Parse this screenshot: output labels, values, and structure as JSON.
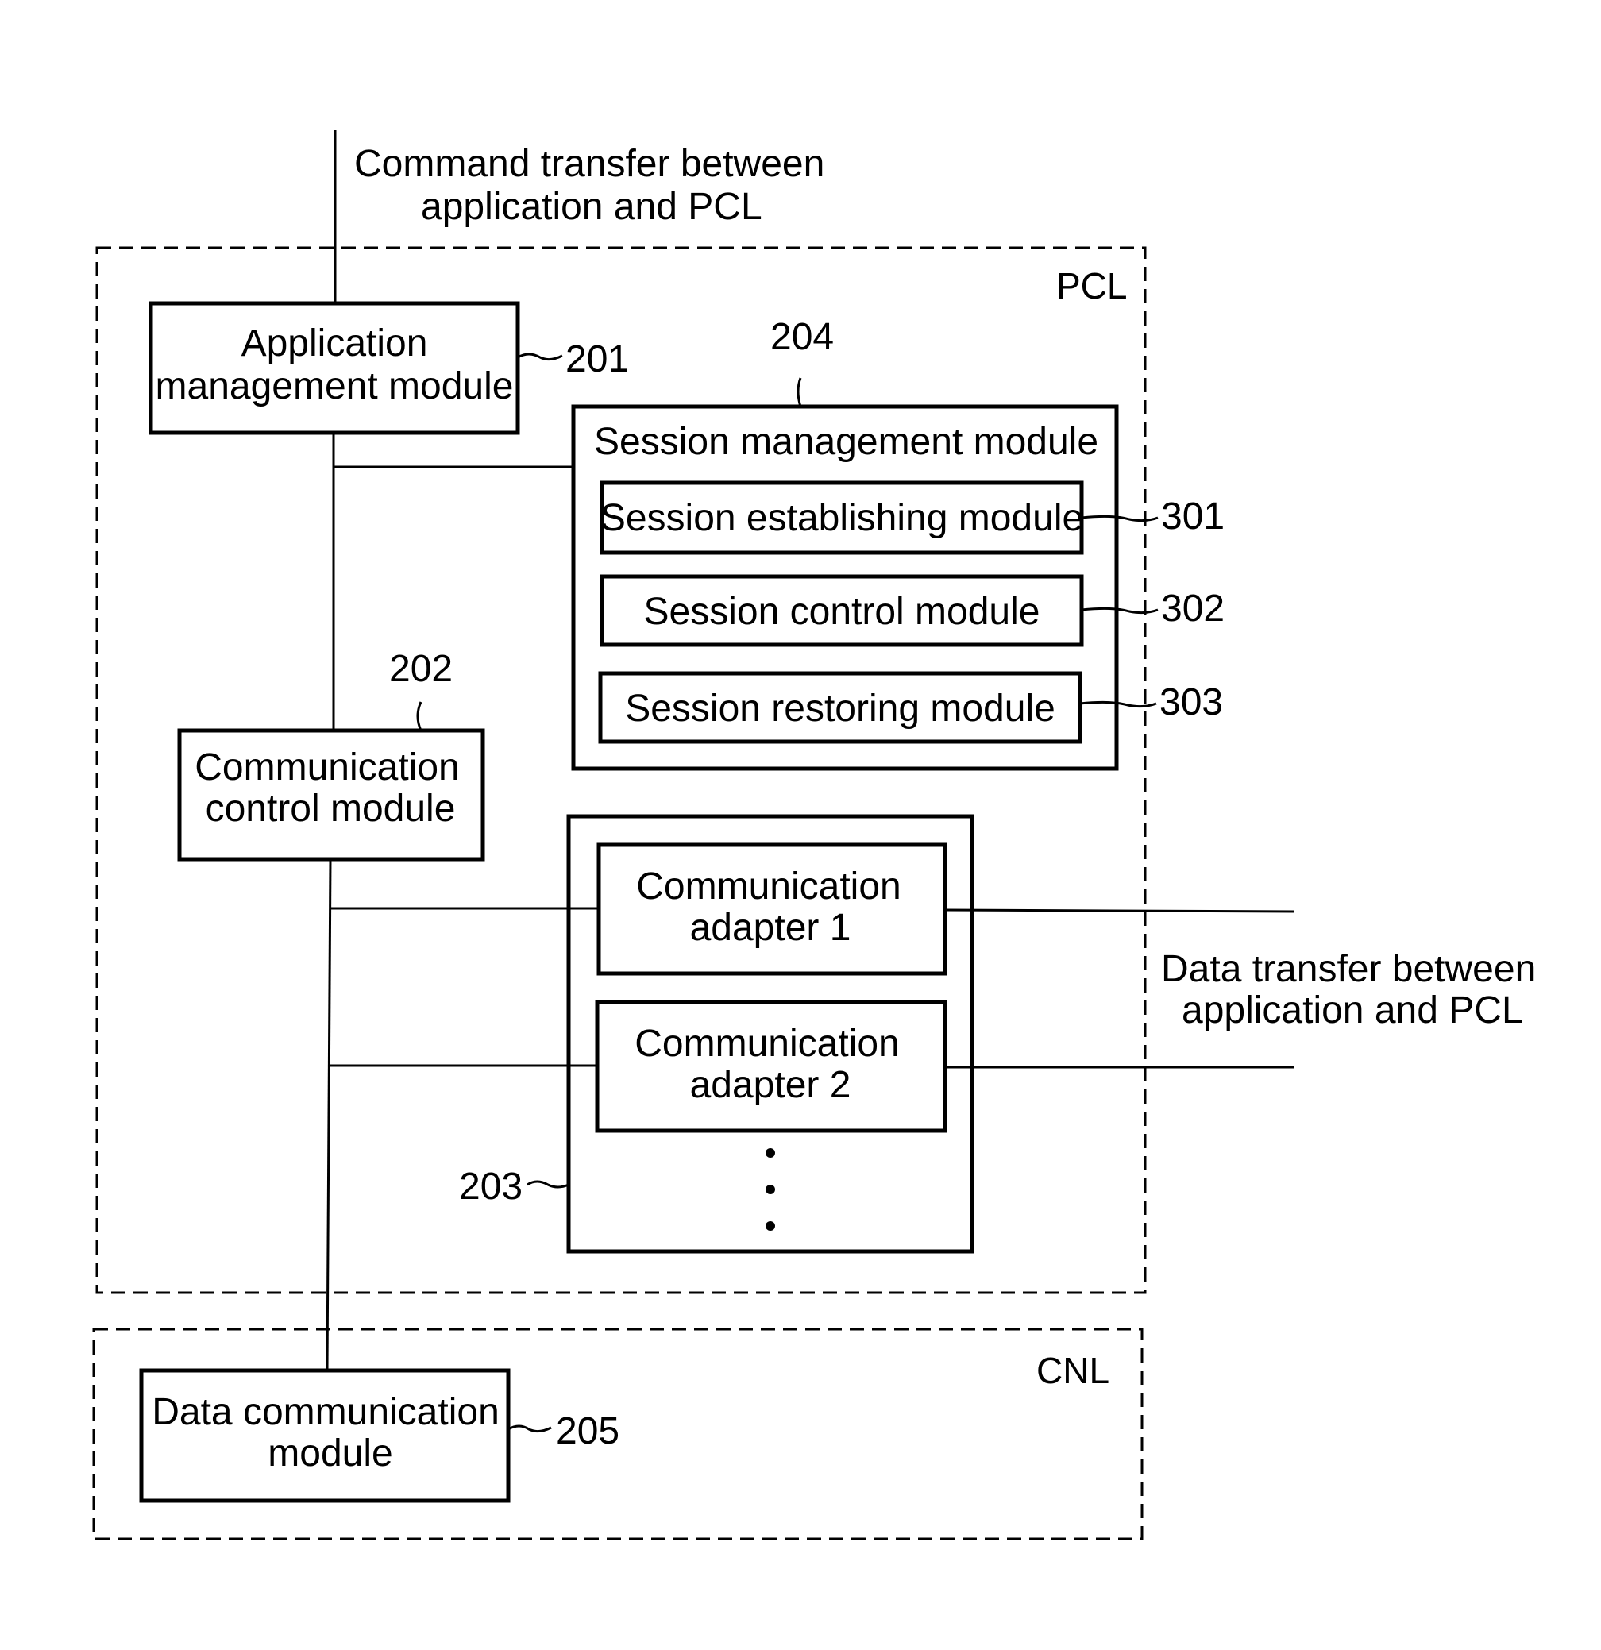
{
  "annotations": {
    "command_transfer": [
      "Command transfer between",
      "application and PCL"
    ],
    "data_transfer": [
      "Data transfer between",
      "application and PCL"
    ]
  },
  "regions": {
    "pcl": "PCL",
    "cnl": "CNL"
  },
  "modules": {
    "app_mgmt": {
      "lines": [
        "Application",
        "management module"
      ],
      "ref": "201"
    },
    "comm_ctrl": {
      "lines": [
        "Communication",
        "control module"
      ],
      "ref": "202"
    },
    "adapters_group": {
      "ref": "203"
    },
    "adapter1": {
      "lines": [
        "Communication",
        "adapter 1"
      ]
    },
    "adapter2": {
      "lines": [
        "Communication",
        "adapter 2"
      ]
    },
    "session_mgmt": {
      "label": "Session management module",
      "ref": "204"
    },
    "session_est": {
      "label": "Session establishing module",
      "ref": "301"
    },
    "session_ctrl": {
      "label": "Session control module",
      "ref": "302"
    },
    "session_rest": {
      "label": "Session restoring module",
      "ref": "303"
    },
    "data_comm": {
      "lines": [
        "Data communication",
        "module"
      ],
      "ref": "205"
    }
  }
}
